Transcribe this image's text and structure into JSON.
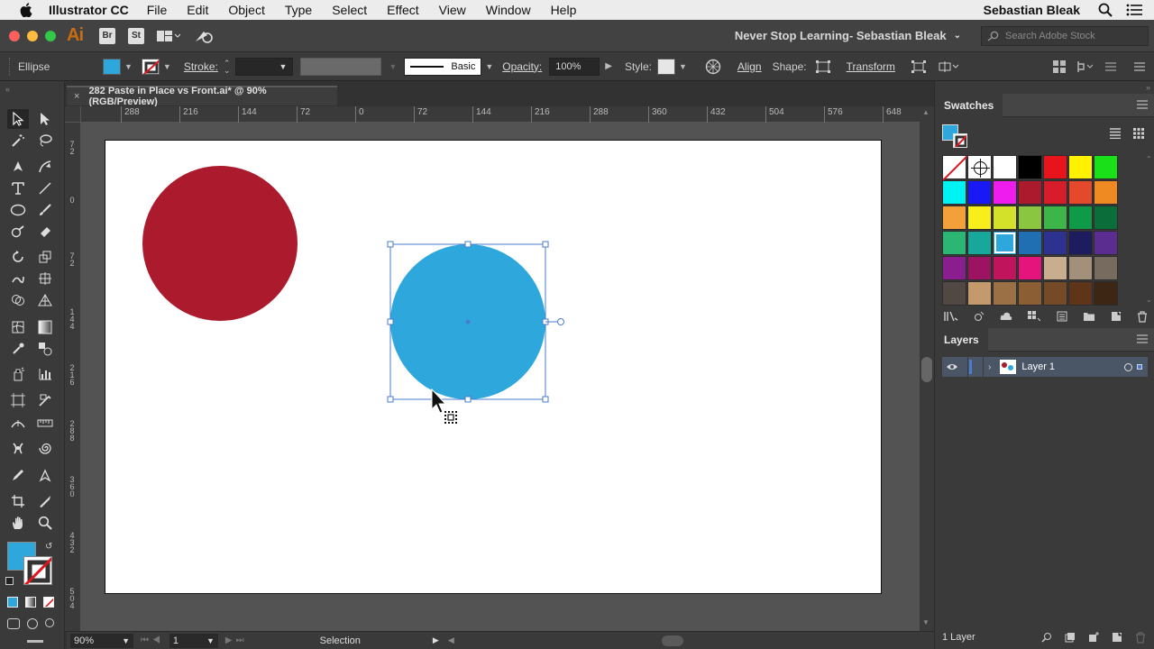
{
  "menubar": {
    "app_name": "Illustrator CC",
    "items": [
      "File",
      "Edit",
      "Object",
      "Type",
      "Select",
      "Effect",
      "View",
      "Window",
      "Help"
    ],
    "user": "Sebastian Bleak"
  },
  "appbar": {
    "logo": "Ai",
    "bridge": "Br",
    "stock": "St",
    "workspace": "Never Stop Learning- Sebastian Bleak",
    "search_placeholder": "Search Adobe Stock"
  },
  "control": {
    "object_type": "Ellipse",
    "fill_color": "#2ea8dc",
    "stroke_label": "Stroke:",
    "brush_label": "Basic",
    "opacity_label": "Opacity:",
    "opacity_value": "100%",
    "style_label": "Style:",
    "align": "Align",
    "shape": "Shape:",
    "transform": "Transform"
  },
  "document": {
    "tab_title": "282 Paste in Place vs Front.ai* @ 90% (RGB/Preview)",
    "close": "×"
  },
  "rulers": {
    "h_ticks": [
      "288",
      "216",
      "144",
      "72",
      "0",
      "72",
      "144",
      "216",
      "288",
      "360",
      "432",
      "504",
      "576",
      "648"
    ],
    "v_ticks": [
      "72",
      "0",
      "72",
      "144",
      "216",
      "288",
      "360",
      "432",
      "504"
    ]
  },
  "artwork": {
    "red_circle_color": "#ab1a2d",
    "blue_circle_color": "#2ea8dc",
    "selection_color": "#4a7bd0"
  },
  "statusbar": {
    "zoom": "90%",
    "artboard_num": "1",
    "tool": "Selection"
  },
  "swatches": {
    "title": "Swatches",
    "colors": [
      "none",
      "registration",
      "#ffffff",
      "#000000",
      "#e8141c",
      "#fff200",
      "#19e018",
      "#00f3f3",
      "#1919f5",
      "#ef1cef",
      "#ab1a2d",
      "#d81d2a",
      "#e5492c",
      "#ef8a22",
      "#f2a13a",
      "#f7ee1c",
      "#d4e12a",
      "#8ac640",
      "#3db549",
      "#0f9a47",
      "#0b6e3a",
      "#2bb673",
      "#18a89b",
      "#2ea8dc",
      "#1f6fb2",
      "#2d3190",
      "#1d1c5e",
      "#5c2d91",
      "#8b1e8f",
      "#9c1461",
      "#c0145d",
      "#e5137c",
      "#c8ae8e",
      "#a3907b",
      "#776a5f",
      "#524843",
      "#c49a6c",
      "#9c7045",
      "#8b5e34",
      "#744b26",
      "#5e3518",
      "#3d2714"
    ],
    "selected_index": 23
  },
  "layers": {
    "title": "Layers",
    "layer_name": "Layer 1",
    "count": "1 Layer"
  }
}
